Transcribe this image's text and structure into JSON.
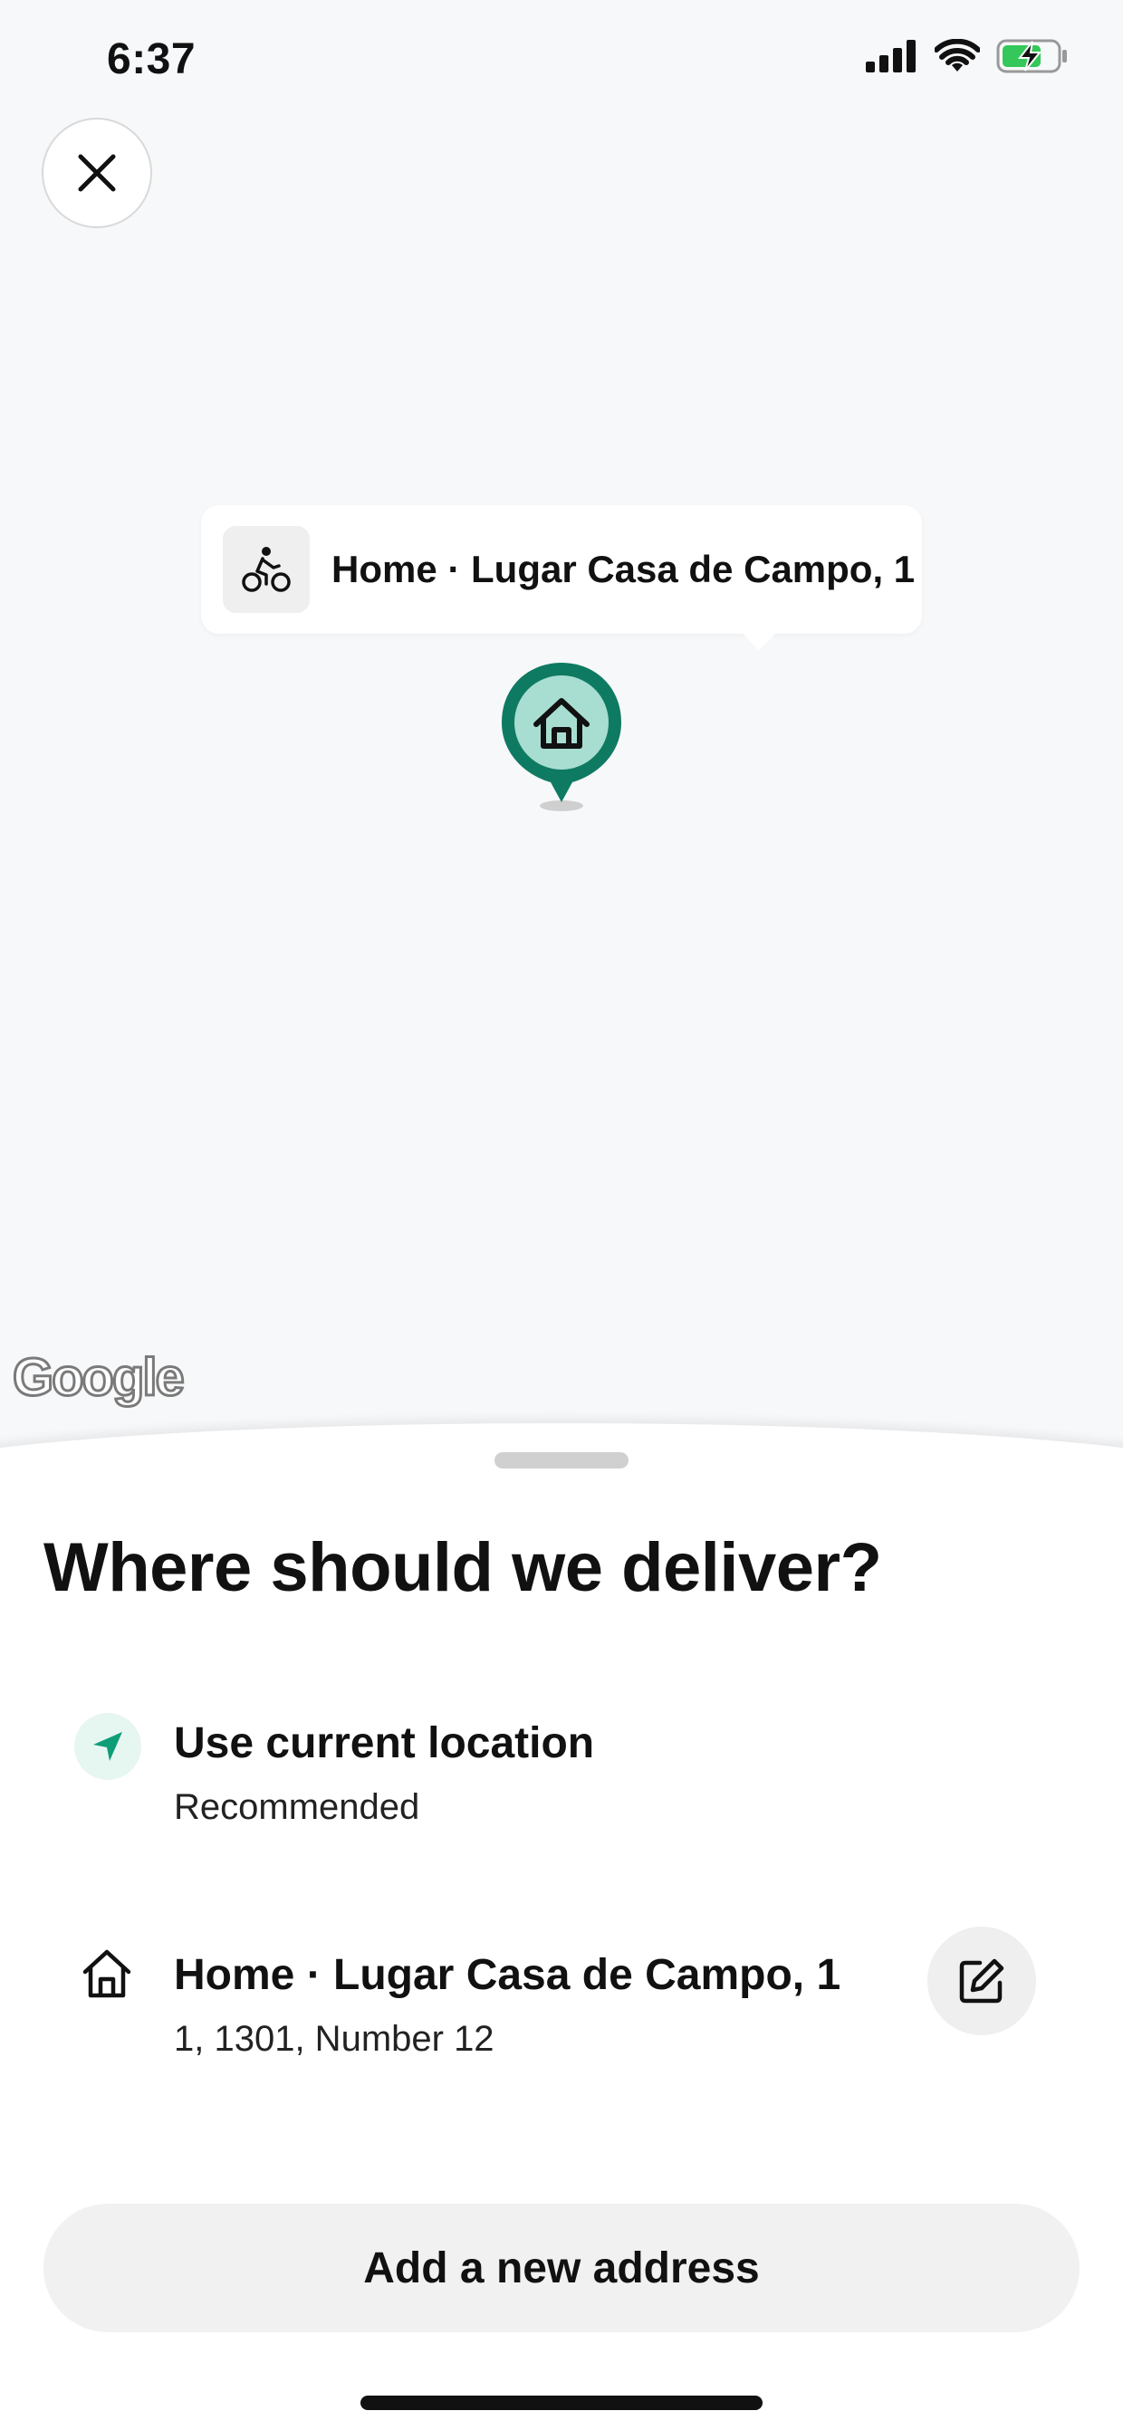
{
  "status_bar": {
    "time": "6:37",
    "icons": [
      "cellular-signal-icon",
      "wifi-icon",
      "battery-charging-icon"
    ]
  },
  "map": {
    "callout_label": "Home · Lugar Casa de Campo, 1",
    "callout_icon": "bike-courier-icon",
    "pin_icon": "home-icon",
    "attribution": "Google",
    "colors": {
      "pin_fill": "#a8ded1",
      "pin_border": "#0f7a62",
      "background": "#f7f8fa"
    }
  },
  "sheet": {
    "title": "Where should we deliver?",
    "options": [
      {
        "title": "Use current location",
        "subtitle": "Recommended",
        "icon": "navigation-arrow-icon",
        "accent": "#0f9d78"
      },
      {
        "title": "Home · Lugar Casa de Campo, 1",
        "subtitle": "1, 1301, Number 12",
        "icon": "home-icon",
        "action_icon": "edit-icon"
      }
    ],
    "add_button_label": "Add a new address"
  }
}
